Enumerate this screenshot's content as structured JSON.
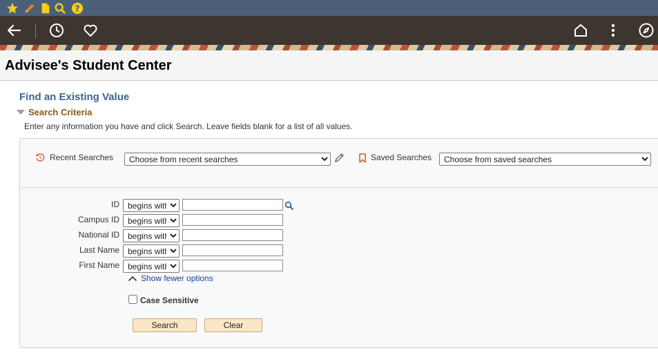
{
  "page": {
    "title": "Advisee's Student Center",
    "find_heading": "Find an Existing Value",
    "criteria_label": "Search Criteria",
    "instructions": "Enter any information you have and click Search. Leave fields blank for a list of all values."
  },
  "recent": {
    "label": "Recent Searches",
    "selected": "Choose from recent searches"
  },
  "saved": {
    "label": "Saved Searches",
    "selected": "Choose from saved searches"
  },
  "fields": [
    {
      "label": "ID",
      "operator": "begins with",
      "value": ""
    },
    {
      "label": "Campus ID",
      "operator": "begins with",
      "value": ""
    },
    {
      "label": "National ID",
      "operator": "begins with",
      "value": ""
    },
    {
      "label": "Last Name",
      "operator": "begins with",
      "value": ""
    },
    {
      "label": "First Name",
      "operator": "begins with",
      "value": ""
    }
  ],
  "show_fewer": "Show fewer options",
  "case_sensitive": "Case Sensitive",
  "buttons": {
    "search": "Search",
    "clear": "Clear"
  },
  "icons": {
    "top": [
      "star-icon",
      "pencil-icon",
      "document-icon",
      "magnifier-icon",
      "help-icon"
    ],
    "nav": [
      "back-arrow-icon",
      "history-icon",
      "favorites-heart-icon",
      "home-icon",
      "kebab-menu-icon",
      "compass-icon"
    ]
  },
  "colors": {
    "top_strip": "#4b6078",
    "nav_bar": "#3d3530",
    "heading_blue": "#3c6491",
    "criteria_brown": "#8a5a14",
    "button_fill": "#fbe7c6",
    "link_blue": "#1a3ca0",
    "accent_orange": "#d65a3c"
  }
}
